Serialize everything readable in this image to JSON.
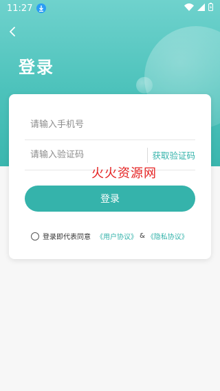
{
  "status_bar": {
    "time": "11:27"
  },
  "header": {
    "title": "登录"
  },
  "form": {
    "phone_placeholder": "请输入手机号",
    "code_placeholder": "请输入验证码",
    "get_code_label": "获取验证码",
    "login_label": "登录"
  },
  "agreement": {
    "prefix": "登录即代表同意",
    "user_agreement": "《用户协议》",
    "ampersand": "&",
    "privacy_agreement": "《隐私协议》"
  },
  "watermark": {
    "text": "火火资源网"
  },
  "colors": {
    "accent": "#35b3ab",
    "header_top": "#6fd2cd",
    "header_bottom": "#3bb6ae",
    "watermark": "#e52222"
  }
}
